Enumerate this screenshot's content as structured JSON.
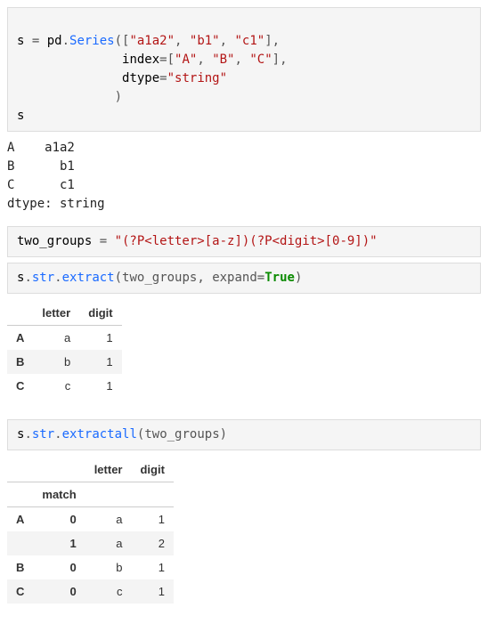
{
  "code1": {
    "line1": {
      "a": "s ",
      "b": "= ",
      "c": "pd",
      "d": ".",
      "e": "Series",
      "f": "([",
      "s1": "\"a1a2\"",
      "g": ", ",
      "s2": "\"b1\"",
      "h": ", ",
      "s3": "\"c1\"",
      "i": "],"
    },
    "line2": {
      "a": "              index",
      "b": "=[",
      "s1": "\"A\"",
      "c": ", ",
      "s2": "\"B\"",
      "d": ", ",
      "s3": "\"C\"",
      "e": "],"
    },
    "line3": {
      "a": "              dtype",
      "b": "=",
      "s1": "\"string\""
    },
    "line4": {
      "a": "             )"
    },
    "line5": {
      "a": "s"
    }
  },
  "output1": "A    a1a2\nB      b1\nC      c1\ndtype: string",
  "code2": {
    "a": "two_groups ",
    "b": "= ",
    "s1": "\"(?P<letter>[a-z])(?P<digit>[0-9])\""
  },
  "code3": {
    "a": "s",
    "b": ".",
    "c": "str",
    "d": ".",
    "e": "extract",
    "f": "(two_groups, expand",
    "g": "=",
    "h": "True",
    "i": ")"
  },
  "table1": {
    "cols": [
      "letter",
      "digit"
    ],
    "rows": [
      {
        "idx": "A",
        "letter": "a",
        "digit": "1"
      },
      {
        "idx": "B",
        "letter": "b",
        "digit": "1"
      },
      {
        "idx": "C",
        "letter": "c",
        "digit": "1"
      }
    ]
  },
  "code4": {
    "a": "s",
    "b": ".",
    "c": "str",
    "d": ".",
    "e": "extractall",
    "f": "(two_groups)"
  },
  "table2": {
    "cols": [
      "letter",
      "digit"
    ],
    "level_name": "match",
    "rows": [
      {
        "idx0": "A",
        "idx1": "0",
        "letter": "a",
        "digit": "1"
      },
      {
        "idx0": "",
        "idx1": "1",
        "letter": "a",
        "digit": "2"
      },
      {
        "idx0": "B",
        "idx1": "0",
        "letter": "b",
        "digit": "1"
      },
      {
        "idx0": "C",
        "idx1": "0",
        "letter": "c",
        "digit": "1"
      }
    ]
  }
}
